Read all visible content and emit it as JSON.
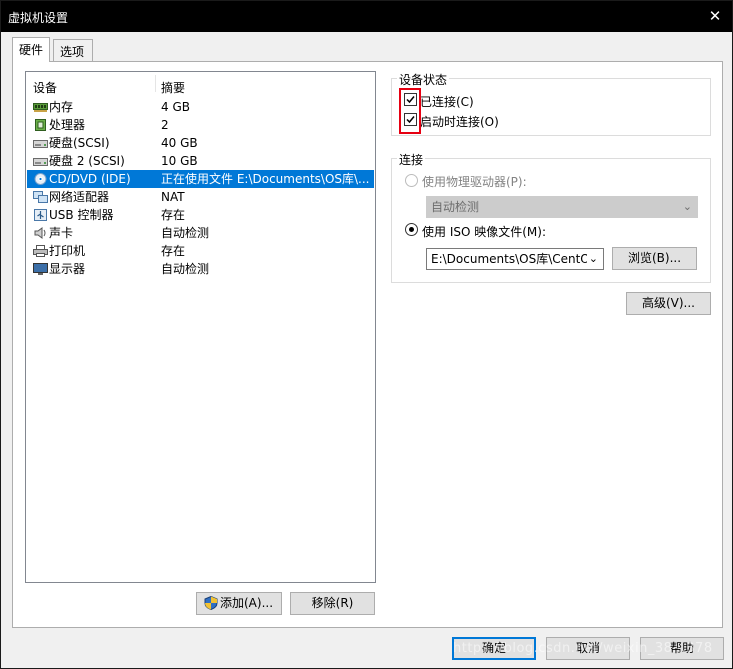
{
  "window": {
    "title": "虚拟机设置",
    "close_glyph": "✕"
  },
  "tabs": [
    {
      "label": "硬件",
      "active": true
    },
    {
      "label": "选项",
      "active": false
    }
  ],
  "device_list": {
    "columns": [
      "设备",
      "摘要"
    ],
    "rows": [
      {
        "name": "内存",
        "summary": "4 GB",
        "icon": "memory-icon"
      },
      {
        "name": "处理器",
        "summary": "2",
        "icon": "processor-icon"
      },
      {
        "name": "硬盘(SCSI)",
        "summary": "40 GB",
        "icon": "hard-disk-icon"
      },
      {
        "name": "硬盘 2 (SCSI)",
        "summary": "10 GB",
        "icon": "hard-disk-icon"
      },
      {
        "name": "CD/DVD (IDE)",
        "summary": "正在使用文件 E:\\Documents\\OS库\\...",
        "icon": "cd-dvd-icon",
        "selected": true
      },
      {
        "name": "网络适配器",
        "summary": "NAT",
        "icon": "network-adapter-icon"
      },
      {
        "name": "USB 控制器",
        "summary": "存在",
        "icon": "usb-icon"
      },
      {
        "name": "声卡",
        "summary": "自动检测",
        "icon": "sound-card-icon"
      },
      {
        "name": "打印机",
        "summary": "存在",
        "icon": "printer-icon"
      },
      {
        "name": "显示器",
        "summary": "自动检测",
        "icon": "display-icon"
      }
    ]
  },
  "list_buttons": {
    "add": "添加(A)...",
    "remove": "移除(R)"
  },
  "device_status": {
    "title": "设备状态",
    "connected": {
      "label": "已连接(C)",
      "checked": true
    },
    "connect_at_power_on": {
      "label": "启动时连接(O)",
      "checked": true
    }
  },
  "connection": {
    "title": "连接",
    "physical": {
      "label": "使用物理驱动器(P):",
      "selected": false,
      "disabled": true
    },
    "physical_select": {
      "value": "自动检测",
      "disabled": true
    },
    "iso": {
      "label": "使用 ISO 映像文件(M):",
      "selected": true
    },
    "iso_path": "E:\\Documents\\OS库\\CentO",
    "browse": "浏览(B)..."
  },
  "advanced_button": "高级(V)...",
  "footer": {
    "ok": "确定",
    "cancel": "取消",
    "help": "帮助"
  },
  "watermark": "https://blog.csdn.net/weixin_38...378",
  "colors": {
    "selection": "#0078d7",
    "highlight": "#e60012",
    "titlebar": "#000000"
  }
}
